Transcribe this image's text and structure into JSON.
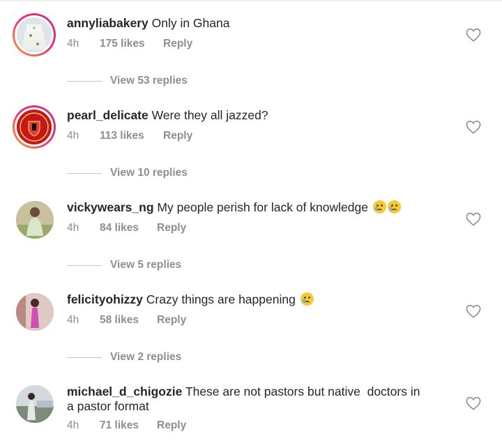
{
  "comments": [
    {
      "username": "annyliabakery",
      "text": "Only in Ghana",
      "time": "4h",
      "likes": "175 likes",
      "reply": "Reply",
      "view_replies": "View 53 replies",
      "heart_icon": "heart-outline-icon"
    },
    {
      "username": "pearl_delicate",
      "text": "Were they all jazzed?",
      "time": "4h",
      "likes": "113 likes",
      "reply": "Reply",
      "view_replies": "View 10 replies",
      "heart_icon": "heart-outline-icon"
    },
    {
      "username": "vickywears_ng",
      "text": "My people perish for lack of knowledge",
      "emoji": "😢😢",
      "time": "4h",
      "likes": "84 likes",
      "reply": "Reply",
      "view_replies": "View 5 replies",
      "heart_icon": "heart-outline-icon"
    },
    {
      "username": "felicityohizzy",
      "text": "Crazy things are happening",
      "emoji": "😢",
      "time": "4h",
      "likes": "58 likes",
      "reply": "Reply",
      "view_replies": "View 2 replies",
      "heart_icon": "heart-outline-icon"
    },
    {
      "username": "michael_d_chigozie",
      "text": "These are not pastors but native  doctors in a pastor format",
      "time": "4h",
      "likes": "71 likes",
      "reply": "Reply",
      "heart_icon": "heart-outline-icon"
    }
  ],
  "colors": {
    "text": "#262626",
    "meta": "#8e8e8e",
    "story_ring_start": "#f9a13a",
    "story_ring_end": "#c13584",
    "manutd_red": "#d71920"
  }
}
